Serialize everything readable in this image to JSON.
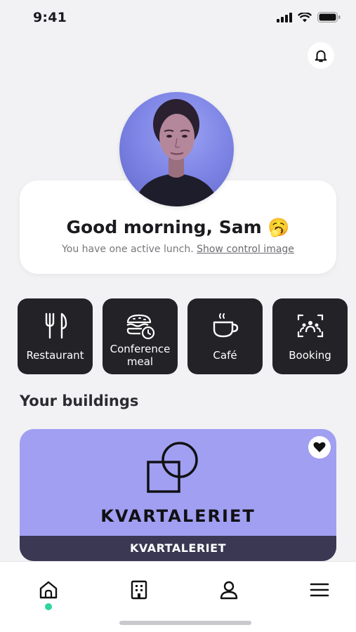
{
  "status_bar": {
    "time": "9:41"
  },
  "greeting": {
    "title": "Good morning, Sam",
    "emoji": "🥱",
    "subtitle": "You have one active lunch.",
    "link": "Show control image"
  },
  "tiles": [
    {
      "label": "Restaurant",
      "icon": "cutlery-icon"
    },
    {
      "label": "Conference\nmeal",
      "icon": "conference-meal-icon"
    },
    {
      "label": "Café",
      "icon": "coffee-cup-icon"
    },
    {
      "label": "Booking",
      "icon": "booking-icon"
    }
  ],
  "buildings": {
    "section_title": "Your buildings",
    "items": [
      {
        "wordmark": "KVARTALERIET",
        "name": "KVARTALERIET",
        "favorited": true,
        "color": "#a19ff2"
      }
    ]
  },
  "nav": {
    "items": [
      "home-icon",
      "building-icon",
      "profile-icon",
      "menu-icon"
    ],
    "active": "home",
    "active_color": "#2ed69a"
  }
}
